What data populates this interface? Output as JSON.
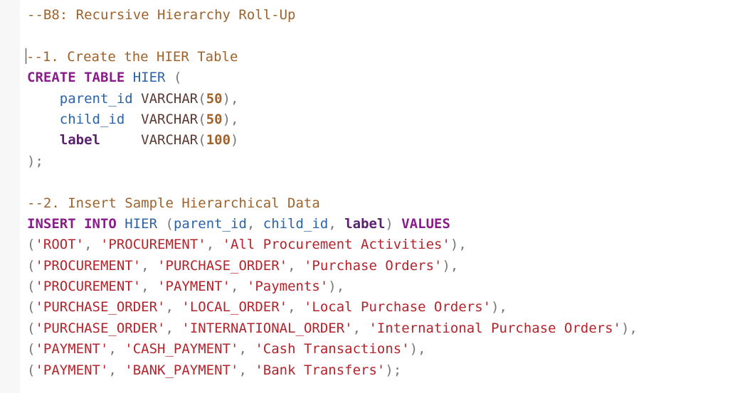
{
  "editor": {
    "lines": [
      [
        {
          "c": "cmt",
          "t": "--B8: Recursive Hierarchy Roll-Up"
        }
      ],
      [],
      [
        {
          "c": "cursor",
          "t": ""
        },
        {
          "c": "cmt",
          "t": "--1. Create the HIER Table"
        }
      ],
      [
        {
          "c": "kw",
          "t": "CREATE TABLE"
        },
        {
          "c": "pun",
          "t": " "
        },
        {
          "c": "id",
          "t": "HIER"
        },
        {
          "c": "pun",
          "t": " ("
        }
      ],
      [
        {
          "c": "pun",
          "t": "    "
        },
        {
          "c": "id",
          "t": "parent_id"
        },
        {
          "c": "pun",
          "t": " "
        },
        {
          "c": "typ",
          "t": "VARCHAR"
        },
        {
          "c": "pun",
          "t": "("
        },
        {
          "c": "num",
          "t": "50"
        },
        {
          "c": "pun",
          "t": "),"
        }
      ],
      [
        {
          "c": "pun",
          "t": "    "
        },
        {
          "c": "id",
          "t": "child_id"
        },
        {
          "c": "pun",
          "t": "  "
        },
        {
          "c": "typ",
          "t": "VARCHAR"
        },
        {
          "c": "pun",
          "t": "("
        },
        {
          "c": "num",
          "t": "50"
        },
        {
          "c": "pun",
          "t": "),"
        }
      ],
      [
        {
          "c": "pun",
          "t": "    "
        },
        {
          "c": "lbl",
          "t": "label"
        },
        {
          "c": "pun",
          "t": "     "
        },
        {
          "c": "typ",
          "t": "VARCHAR"
        },
        {
          "c": "pun",
          "t": "("
        },
        {
          "c": "num",
          "t": "100"
        },
        {
          "c": "pun",
          "t": ")"
        }
      ],
      [
        {
          "c": "pun",
          "t": ");"
        }
      ],
      [],
      [
        {
          "c": "cmt",
          "t": "--2. Insert Sample Hierarchical Data"
        }
      ],
      [
        {
          "c": "kw",
          "t": "INSERT INTO"
        },
        {
          "c": "pun",
          "t": " "
        },
        {
          "c": "id",
          "t": "HIER"
        },
        {
          "c": "pun",
          "t": " ("
        },
        {
          "c": "id",
          "t": "parent_id"
        },
        {
          "c": "pun",
          "t": ", "
        },
        {
          "c": "id",
          "t": "child_id"
        },
        {
          "c": "pun",
          "t": ", "
        },
        {
          "c": "lbl",
          "t": "label"
        },
        {
          "c": "pun",
          "t": ") "
        },
        {
          "c": "kw",
          "t": "VALUES"
        }
      ],
      [
        {
          "c": "pun",
          "t": "("
        },
        {
          "c": "str",
          "t": "'ROOT'"
        },
        {
          "c": "pun",
          "t": ", "
        },
        {
          "c": "str",
          "t": "'PROCUREMENT'"
        },
        {
          "c": "pun",
          "t": ", "
        },
        {
          "c": "str",
          "t": "'All Procurement Activities'"
        },
        {
          "c": "pun",
          "t": "),"
        }
      ],
      [
        {
          "c": "pun",
          "t": "("
        },
        {
          "c": "str",
          "t": "'PROCUREMENT'"
        },
        {
          "c": "pun",
          "t": ", "
        },
        {
          "c": "str",
          "t": "'PURCHASE_ORDER'"
        },
        {
          "c": "pun",
          "t": ", "
        },
        {
          "c": "str",
          "t": "'Purchase Orders'"
        },
        {
          "c": "pun",
          "t": "),"
        }
      ],
      [
        {
          "c": "pun",
          "t": "("
        },
        {
          "c": "str",
          "t": "'PROCUREMENT'"
        },
        {
          "c": "pun",
          "t": ", "
        },
        {
          "c": "str",
          "t": "'PAYMENT'"
        },
        {
          "c": "pun",
          "t": ", "
        },
        {
          "c": "str",
          "t": "'Payments'"
        },
        {
          "c": "pun",
          "t": "),"
        }
      ],
      [
        {
          "c": "pun",
          "t": "("
        },
        {
          "c": "str",
          "t": "'PURCHASE_ORDER'"
        },
        {
          "c": "pun",
          "t": ", "
        },
        {
          "c": "str",
          "t": "'LOCAL_ORDER'"
        },
        {
          "c": "pun",
          "t": ", "
        },
        {
          "c": "str",
          "t": "'Local Purchase Orders'"
        },
        {
          "c": "pun",
          "t": "),"
        }
      ],
      [
        {
          "c": "pun",
          "t": "("
        },
        {
          "c": "str",
          "t": "'PURCHASE_ORDER'"
        },
        {
          "c": "pun",
          "t": ", "
        },
        {
          "c": "str",
          "t": "'INTERNATIONAL_ORDER'"
        },
        {
          "c": "pun",
          "t": ", "
        },
        {
          "c": "str",
          "t": "'International Purchase Orders'"
        },
        {
          "c": "pun",
          "t": "),"
        }
      ],
      [
        {
          "c": "pun",
          "t": "("
        },
        {
          "c": "str",
          "t": "'PAYMENT'"
        },
        {
          "c": "pun",
          "t": ", "
        },
        {
          "c": "str",
          "t": "'CASH_PAYMENT'"
        },
        {
          "c": "pun",
          "t": ", "
        },
        {
          "c": "str",
          "t": "'Cash Transactions'"
        },
        {
          "c": "pun",
          "t": "),"
        }
      ],
      [
        {
          "c": "pun",
          "t": "("
        },
        {
          "c": "str",
          "t": "'PAYMENT'"
        },
        {
          "c": "pun",
          "t": ", "
        },
        {
          "c": "str",
          "t": "'BANK_PAYMENT'"
        },
        {
          "c": "pun",
          "t": ", "
        },
        {
          "c": "str",
          "t": "'Bank Transfers'"
        },
        {
          "c": "pun",
          "t": ");"
        }
      ]
    ]
  }
}
